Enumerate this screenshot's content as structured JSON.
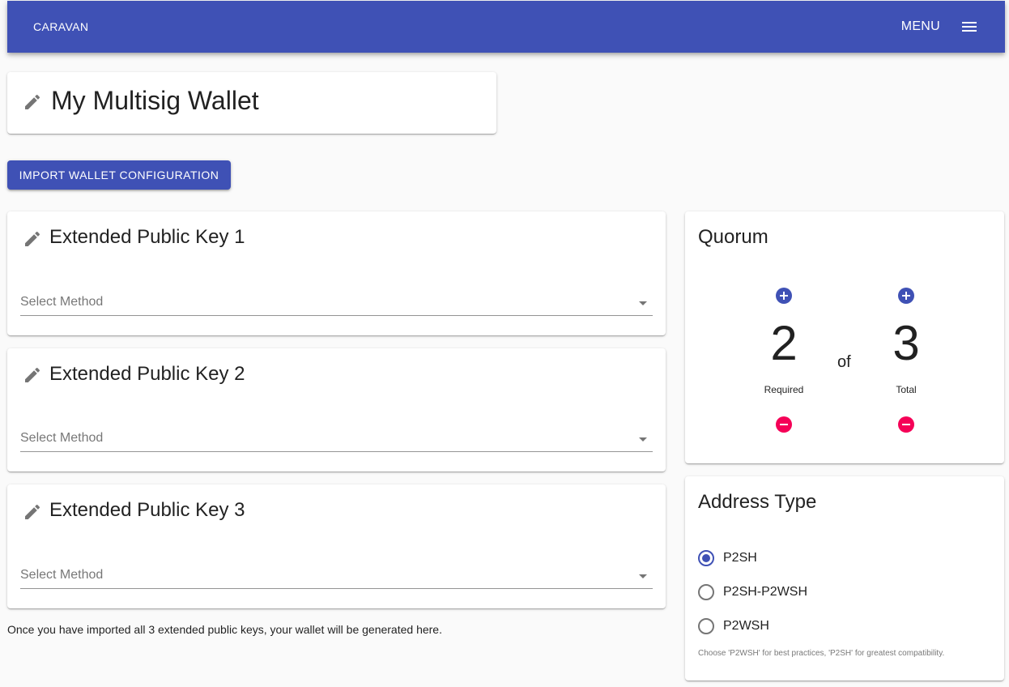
{
  "appbar": {
    "brand": "CARAVAN",
    "menu_label": "MENU",
    "color": "#3f51b5"
  },
  "wallet": {
    "name": "My Multisig Wallet",
    "import_button": "IMPORT WALLET CONFIGURATION"
  },
  "keys": [
    {
      "title": "Extended Public Key 1",
      "select_placeholder": "Select Method"
    },
    {
      "title": "Extended Public Key 2",
      "select_placeholder": "Select Method"
    },
    {
      "title": "Extended Public Key 3",
      "select_placeholder": "Select Method"
    }
  ],
  "footnote": "Once you have imported all 3 extended public keys, your wallet will be generated here.",
  "quorum": {
    "title": "Quorum",
    "required_value": "2",
    "required_caption": "Required",
    "of_label": "of",
    "total_value": "3",
    "total_caption": "Total",
    "increment_color": "#3f51b5",
    "decrement_color": "#f50057"
  },
  "address_type": {
    "title": "Address Type",
    "options": [
      {
        "label": "P2SH",
        "selected": true
      },
      {
        "label": "P2SH-P2WSH",
        "selected": false
      },
      {
        "label": "P2WSH",
        "selected": false
      }
    ],
    "help": "Choose 'P2WSH' for best practices, 'P2SH' for greatest compatibility."
  },
  "icons": {
    "menu": "menu-icon",
    "edit": "pencil-icon",
    "dropdown": "arrow-drop-down-icon",
    "add": "add-circle-icon",
    "remove": "remove-circle-icon"
  }
}
